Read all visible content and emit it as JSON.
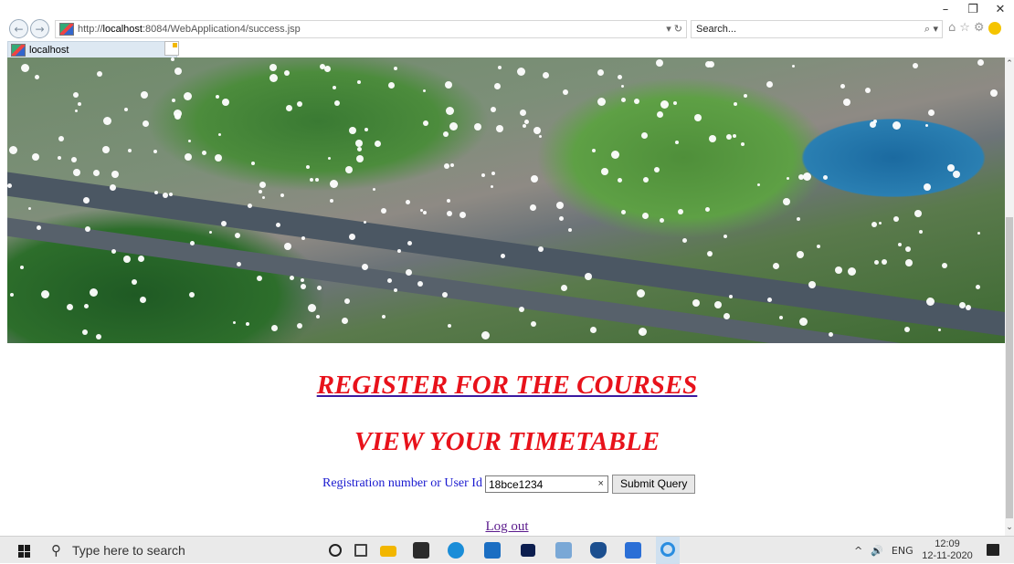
{
  "browser": {
    "window_controls": [
      "–",
      "❐",
      "✕"
    ],
    "back_icon": "back-arrow-icon",
    "forward_icon": "forward-arrow-icon",
    "url_prefix": "http://",
    "url_host": "localhost",
    "url_rest": ":8084/WebApplication4/success.jsp",
    "url_tools": "▾ ↻",
    "search_placeholder": "Search...",
    "search_tools": "⌕ ▾",
    "right_icons": [
      "⌂",
      "☆",
      "⚙"
    ],
    "tab_title": "localhost",
    "tab_close": "×"
  },
  "page": {
    "register_link": "REGISTER FOR THE COURSES",
    "timetable_title": "VIEW YOUR TIMETABLE",
    "form": {
      "label": "Registration number or User Id",
      "value": "18bce1234",
      "clear": "×",
      "submit_label": "Submit Query"
    },
    "logout_link": "Log out"
  },
  "taskbar": {
    "search_placeholder": "Type here to search",
    "search_icon": "⚲",
    "pinned_icons": [
      "cortana-icon",
      "task-view-icon",
      "file-explorer-icon",
      "store-icon",
      "edge-icon",
      "mail-icon",
      "dropbox-icon",
      "amazon-icon",
      "security-icon",
      "app-icon",
      "internet-explorer-icon"
    ],
    "tray_up": "^",
    "tray_volume": "🔊",
    "language": "ENG",
    "time": "12:09",
    "date": "12-11-2020"
  },
  "colors": {
    "title_red": "#e8121b",
    "label_blue": "#1a1ad0",
    "visited_purple": "#5a1a8c"
  }
}
